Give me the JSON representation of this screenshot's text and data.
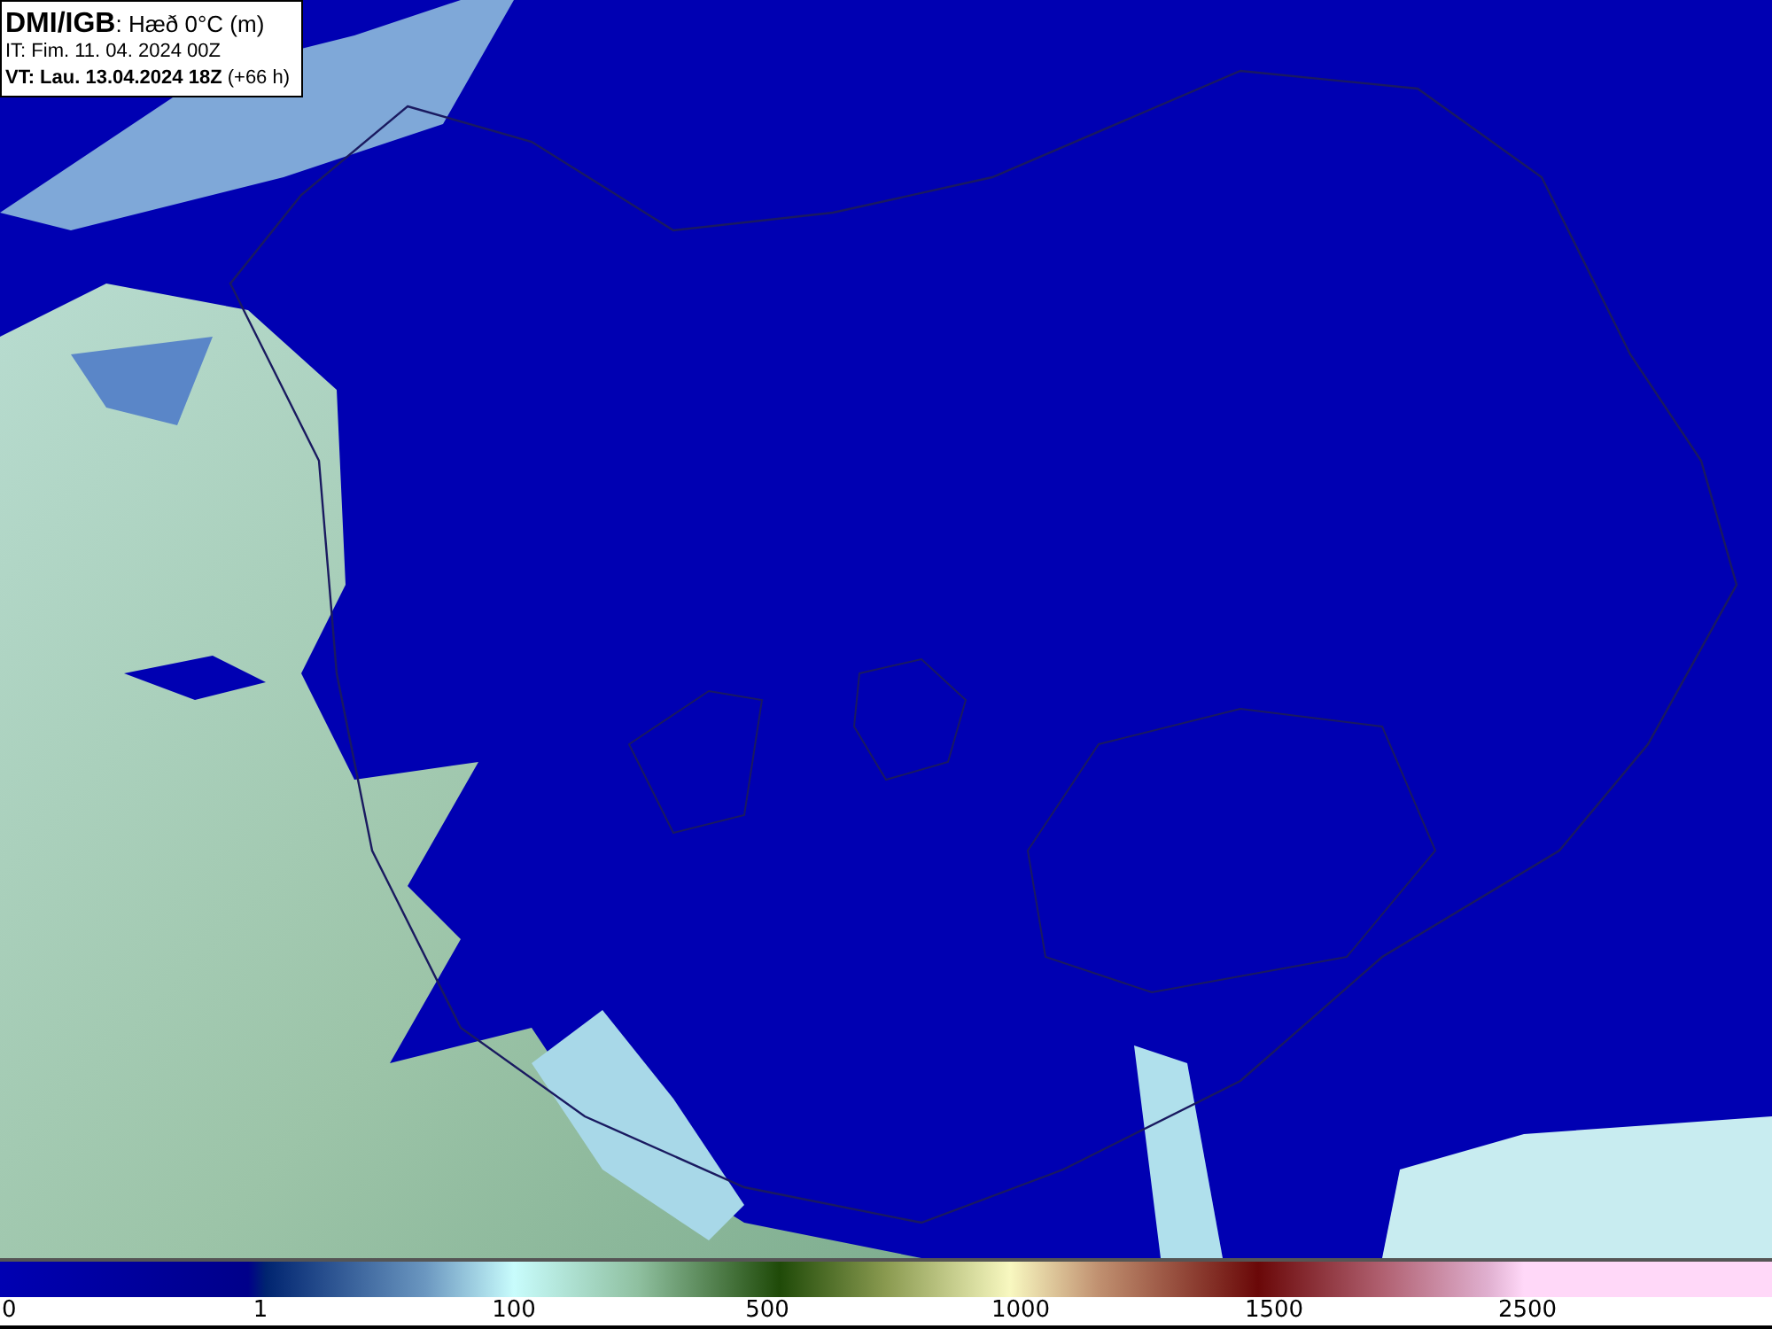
{
  "header": {
    "source": "DMI/IGB",
    "title": ": Hæð 0°C (m)",
    "issue_time": "IT: Fim. 11. 04. 2024 00Z",
    "valid_time": "**VT: Lau. 13.04.2024 18Z** (+66 h)"
  },
  "legend": {
    "ticks": [
      "0",
      "1",
      "100",
      "500",
      "1000",
      "1500",
      "2500"
    ]
  }
}
